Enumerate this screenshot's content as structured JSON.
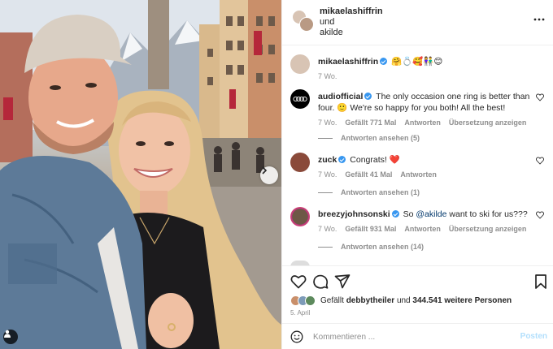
{
  "post": {
    "author": "mikaelashiffrin",
    "collab_joiner": "und",
    "collaborator": "akilde"
  },
  "caption": {
    "username": "mikaelashiffrin",
    "emojis": "🤗💍🥰👫😊",
    "time": "7 Wo."
  },
  "comments": [
    {
      "username": "audiofficial",
      "text": "The only occasion one ring is better than four. 🙂 We're so happy for you both! All the best!",
      "time": "7 Wo.",
      "likes": "Gefällt 771 Mal",
      "reply": "Antworten",
      "translate": "Übersetzung anzeigen",
      "view_replies": "Antworten ansehen (5)"
    },
    {
      "username": "zuck",
      "text": "Congrats! ❤️",
      "time": "7 Wo.",
      "likes": "Gefällt 41 Mal",
      "reply": "Antworten",
      "view_replies": "Antworten ansehen (1)"
    },
    {
      "username": "breezyjohnsonski",
      "text_pre": "So ",
      "mention": "@akilde",
      "text_post": " want to ski for us???",
      "time": "7 Wo.",
      "likes": "Gefällt 931 Mal",
      "reply": "Antworten",
      "translate": "Übersetzung anzeigen",
      "view_replies": "Antworten ansehen (14)"
    }
  ],
  "likes": {
    "prefix": "Gefällt",
    "first_user": "debbytheiler",
    "joiner": "und",
    "others": "344.541 weitere Personen"
  },
  "date": "5. April",
  "comment_box": {
    "placeholder": "Kommentieren ...",
    "post_label": "Posten"
  },
  "colors": {
    "verified": "#3897f0",
    "heart": "#ed4956",
    "post_disabled": "#b2dffc"
  },
  "icons": [
    "more-icon",
    "heart-icon",
    "comment-icon",
    "share-icon",
    "bookmark-icon",
    "emoji-icon",
    "chevron-right-icon",
    "user-tag-icon",
    "verified-icon"
  ]
}
